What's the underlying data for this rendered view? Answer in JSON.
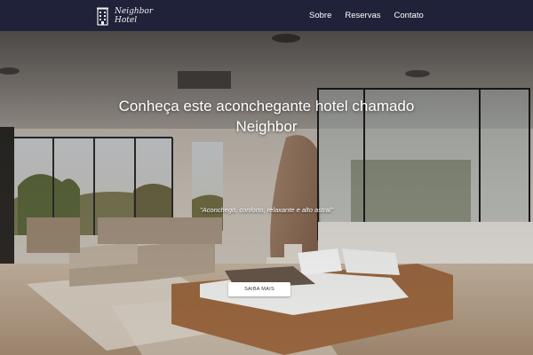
{
  "navbar": {
    "logo": {
      "icon": "building-icon",
      "text": "Neighbor Hotel"
    },
    "links": [
      "Sobre",
      "Reservas",
      "Contato"
    ]
  },
  "hero": {
    "title": "Conheça este aconchegante hotel chamado Neighbor",
    "quote": "\"Aconchego, conforto, relaxante e alto astral\"",
    "button_label": "SAIBA MAIS"
  },
  "colors": {
    "navbar_bg": "#1f2238",
    "nav_text": "#ffffff",
    "button_bg": "#ffffff",
    "button_text": "#333333"
  }
}
